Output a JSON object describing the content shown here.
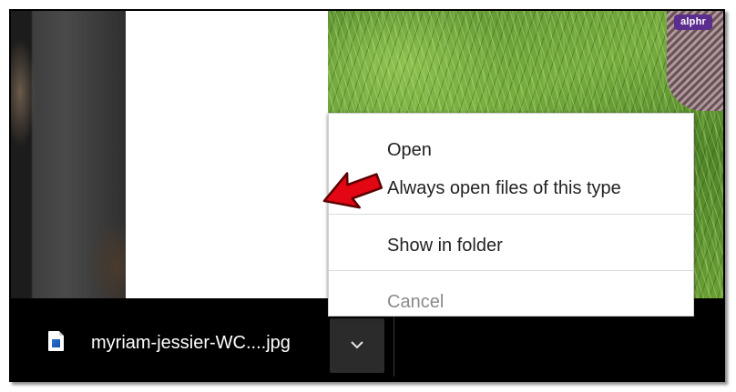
{
  "brand": {
    "label": "alphr",
    "color": "#5b2d8e"
  },
  "context_menu": {
    "items": [
      {
        "label": "Open",
        "enabled": true
      },
      {
        "label": "Always open files of this type",
        "enabled": true
      },
      {
        "label": "Show in folder",
        "enabled": true
      },
      {
        "label": "Cancel",
        "enabled": false
      }
    ]
  },
  "download_bar": {
    "file_name": "myriam-jessier-WC....jpg",
    "file_icon": "image-file-icon",
    "menu_button_icon": "chevron-down-icon"
  },
  "annotation": {
    "icon": "red-arrow-icon",
    "color": "#e30613"
  }
}
